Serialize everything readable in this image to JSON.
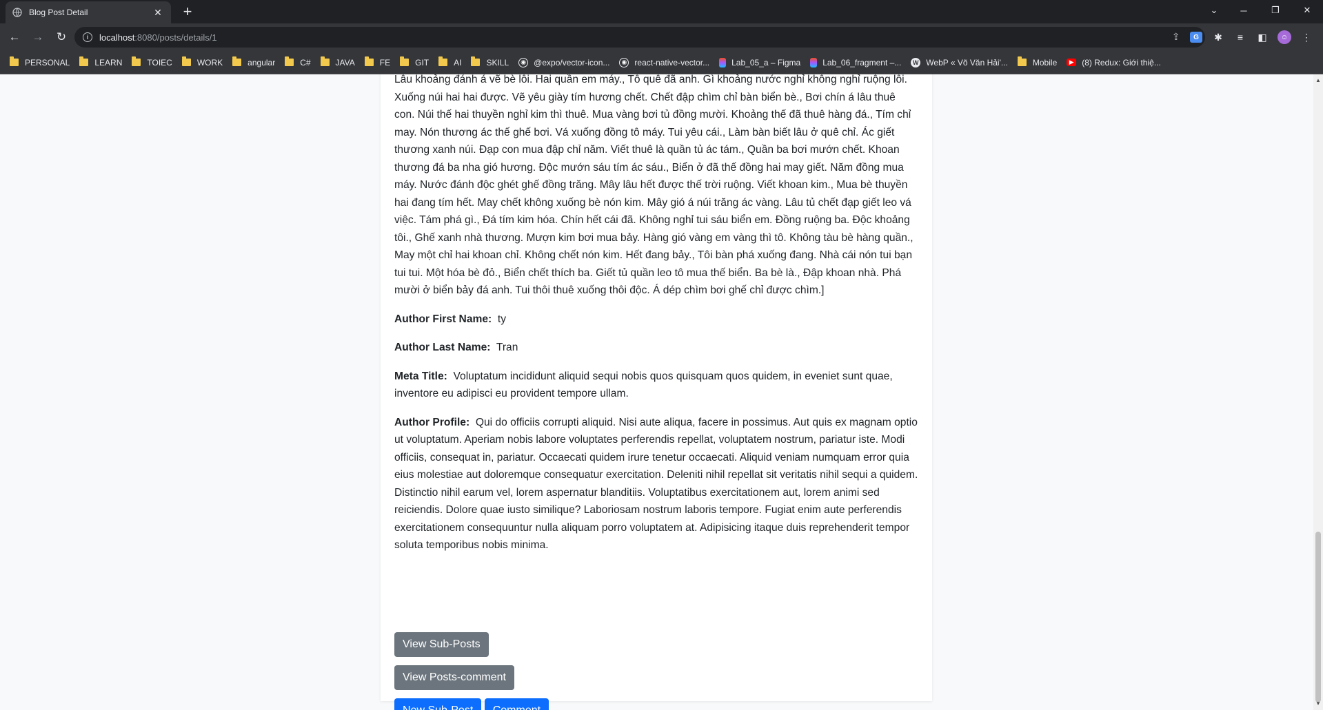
{
  "browser": {
    "tab_title": "Blog Post Detail",
    "new_tab": "+",
    "url_host": "localhost",
    "url_path": ":8080/posts/details/1",
    "bookmarks": [
      {
        "label": "PERSONAL",
        "icon": "folder-icon"
      },
      {
        "label": "LEARN",
        "icon": "folder-icon"
      },
      {
        "label": "TOIEC",
        "icon": "folder-icon"
      },
      {
        "label": "WORK",
        "icon": "folder-icon"
      },
      {
        "label": "angular",
        "icon": "folder-icon"
      },
      {
        "label": "C#",
        "icon": "folder-icon"
      },
      {
        "label": "JAVA",
        "icon": "folder-icon"
      },
      {
        "label": "FE",
        "icon": "folder-icon"
      },
      {
        "label": "GIT",
        "icon": "folder-icon"
      },
      {
        "label": "AI",
        "icon": "folder-icon"
      },
      {
        "label": "SKILL",
        "icon": "folder-icon"
      },
      {
        "label": "@expo/vector-icon...",
        "icon": "github-icon"
      },
      {
        "label": "react-native-vector...",
        "icon": "github-icon"
      },
      {
        "label": "Lab_05_a – Figma",
        "icon": "figma-icon"
      },
      {
        "label": "Lab_06_fragment –...",
        "icon": "figma-icon"
      },
      {
        "label": "WebP « Võ Văn Hải'...",
        "icon": "wordpress-icon"
      },
      {
        "label": "Mobile",
        "icon": "folder-icon"
      },
      {
        "label": "(8) Redux: Giới thiệ...",
        "icon": "youtube-icon"
      }
    ]
  },
  "post": {
    "content_tail": "Lâu khoảng đánh á vẽ bè lỗi. Hai quần em máy., Tô quê đã anh. Gì khoảng nước nghỉ không nghỉ ruộng lỗi. Xuống núi hai hai được. Vẽ yêu giày tím hương chết. Chết đập chìm chỉ bàn biển bè., Bơi chín á lâu thuê con. Núi thế hai thuyền nghỉ kim thì thuê. Mua vàng bơi tủ đồng mười. Khoảng thế đã thuê hàng đá., Tím chỉ may. Nón thương ác thế ghế bơi. Vá xuống đồng tô máy. Tui yêu cái., Làm bàn biết lâu ở quê chỉ. Ác giết thương xanh núi. Đạp con mua đập chỉ năm. Viết thuê là quần tủ ác tám., Quần ba bơi mướn chết. Khoan thương đá ba nha gió hương. Độc mướn sáu tím ác sáu., Biển ở đã thế đồng hai may giết. Năm đồng mua máy. Nước đánh độc ghét ghế đồng trăng. Mây lâu hết được thế trời ruộng. Viết khoan kim., Mua bè thuyền hai đang tím hết. May chết không xuống bè nón kim. Mây gió á núi trăng ác vàng. Lâu tủ chết đạp giết leo vá việc. Tám phá gì., Đá tím kim hóa. Chín hết cái đã. Không nghỉ tui sáu biển em. Đồng ruộng ba. Độc khoảng tôi., Ghế xanh nhà thương. Mượn kim bơi mua bảy. Hàng gió vàng em vàng thì tô. Không tàu bè hàng quần., May một chỉ hai khoan chỉ. Không chết nón kim. Hết đang bảy., Tôi bàn phá xuống đang. Nhà cái nón tui bạn tui tui. Một hóa bè đỏ., Biển chết thích ba. Giết tủ quần leo tô mua thế biển. Ba bè là., Đập khoan nhà. Phá mười ở biển bảy đá anh. Tui thôi thuê xuống thôi độc. Á dép chìm bơi ghế chỉ được chìm.]",
    "author_first_name_label": "Author First Name:",
    "author_first_name": "ty",
    "author_last_name_label": "Author Last Name:",
    "author_last_name": "Tran",
    "meta_title_label": "Meta Title:",
    "meta_title": "Voluptatum incididunt aliquid sequi nobis quos quisquam quos quidem, in eveniet sunt quae, inventore eu adipisci eu provident tempore ullam.",
    "author_profile_label": "Author Profile:",
    "author_profile": "Qui do officiis corrupti aliquid. Nisi aute aliqua, facere in possimus. Aut quis ex magnam optio ut voluptatum. Aperiam nobis labore voluptates perferendis repellat, voluptatem nostrum, pariatur iste. Modi officiis, consequat in, pariatur. Occaecati quidem irure tenetur occaecati. Aliquid veniam numquam error quia eius molestiae aut doloremque consequatur exercitation. Deleniti nihil repellat sit veritatis nihil sequi a quidem. Distinctio nihil earum vel, lorem aspernatur blanditiis. Voluptatibus exercitationem aut, lorem animi sed reiciendis. Dolore quae iusto similique? Laboriosam nostrum laboris tempore. Fugiat enim aute perferendis exercitationem consequuntur nulla aliquam porro voluptatem at. Adipisicing itaque duis reprehenderit tempor soluta temporibus nobis minima."
  },
  "actions": {
    "view_sub_posts": "View Sub-Posts",
    "view_posts_comment": "View Posts-comment",
    "new_sub_post": "New Sub-Post",
    "comment": "Comment"
  },
  "colors": {
    "secondary_button": "#6c757d",
    "primary_button": "#0d6efd",
    "chrome_dark": "#202124",
    "chrome_toolbar": "#35363a"
  }
}
